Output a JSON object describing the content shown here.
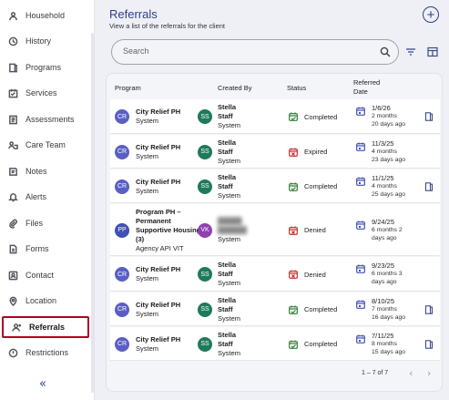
{
  "sidebar": {
    "items": [
      {
        "label": "Household",
        "icon": "household-icon"
      },
      {
        "label": "History",
        "icon": "history-icon"
      },
      {
        "label": "Programs",
        "icon": "programs-icon"
      },
      {
        "label": "Services",
        "icon": "services-icon"
      },
      {
        "label": "Assessments",
        "icon": "assessments-icon"
      },
      {
        "label": "Care Team",
        "icon": "care-team-icon"
      },
      {
        "label": "Notes",
        "icon": "notes-icon"
      },
      {
        "label": "Alerts",
        "icon": "bell-icon"
      },
      {
        "label": "Files",
        "icon": "paperclip-icon"
      },
      {
        "label": "Forms",
        "icon": "forms-icon"
      },
      {
        "label": "Contact",
        "icon": "contact-icon"
      },
      {
        "label": "Location",
        "icon": "location-icon"
      },
      {
        "label": "Referrals",
        "icon": "add-person-icon",
        "active": true
      },
      {
        "label": "Restrictions",
        "icon": "restrictions-icon"
      }
    ],
    "collapse_label": "«"
  },
  "header": {
    "title": "Referrals",
    "subtitle": "View a list of the referrals for the client",
    "add_label": "+"
  },
  "search": {
    "placeholder": "Search"
  },
  "table": {
    "columns": {
      "program": "Program",
      "created_by": "Created By",
      "status": "Status",
      "referred_date_1": "Referred",
      "referred_date_2": "Date"
    },
    "rows": [
      {
        "initials": "CR",
        "program": "City Relief PH",
        "program_sub": "System",
        "creator_initials": "SS",
        "creator_first": "Stella",
        "creator_last": "Staff",
        "creator_sub": "System",
        "status": "Completed",
        "date": "1/6/26",
        "ago1": "2 months",
        "ago2": "20 days ago",
        "bookmark": true
      },
      {
        "initials": "CR",
        "program": "City Relief PH",
        "program_sub": "System",
        "creator_initials": "SS",
        "creator_first": "Stella",
        "creator_last": "Staff",
        "creator_sub": "System",
        "status": "Expired",
        "date": "11/3/25",
        "ago1": "4 months",
        "ago2": "23 days ago",
        "bookmark": false
      },
      {
        "initials": "CR",
        "program": "City Relief PH",
        "program_sub": "System",
        "creator_initials": "SS",
        "creator_first": "Stella",
        "creator_last": "Staff",
        "creator_sub": "System",
        "status": "Completed",
        "date": "11/1/25",
        "ago1": "4 months",
        "ago2": "25 days ago",
        "bookmark": true
      },
      {
        "initials": "PP",
        "program_lines": [
          "Program PH –",
          "Permanent",
          "Supportive Housing",
          "(3)"
        ],
        "program_sub": "Agency API VIT",
        "creator_initials": "VK",
        "creator_sub": "System",
        "status": "Denied",
        "date": "9/24/25",
        "ago1": "6 months 2",
        "ago2": "days ago",
        "bookmark": false
      },
      {
        "initials": "CR",
        "program": "City Relief PH",
        "program_sub": "System",
        "creator_initials": "SS",
        "creator_first": "Stella",
        "creator_last": "Staff",
        "creator_sub": "System",
        "status": "Denied",
        "date": "9/23/25",
        "ago1": "6 months 3",
        "ago2": "days ago",
        "bookmark": false
      },
      {
        "initials": "CR",
        "program": "City Relief PH",
        "program_sub": "System",
        "creator_initials": "SS",
        "creator_first": "Stella",
        "creator_last": "Staff",
        "creator_sub": "System",
        "status": "Completed",
        "date": "8/10/25",
        "ago1": "7 months",
        "ago2": "16 days ago",
        "bookmark": true
      },
      {
        "initials": "CR",
        "program": "City Relief PH",
        "program_sub": "System",
        "creator_initials": "SS",
        "creator_first": "Stella",
        "creator_last": "Staff",
        "creator_sub": "System",
        "status": "Completed",
        "date": "7/11/25",
        "ago1": "8 months",
        "ago2": "15 days ago",
        "bookmark": true
      }
    ],
    "pagination": "1 – 7 of 7",
    "prev_label": "‹",
    "next_label": "›"
  },
  "colors": {
    "accent": "#2f3d8a",
    "avatar_program": "#5a5fc4",
    "avatar_program_pp": "#3f51b5",
    "avatar_creator": "#1e7a5a",
    "avatar_creator_vk": "#8e3fb0",
    "completed": "#2e7d32",
    "expired": "#c62828",
    "denied": "#c62828",
    "date_icon": "#3f51b5",
    "active_border": "#b00020"
  }
}
